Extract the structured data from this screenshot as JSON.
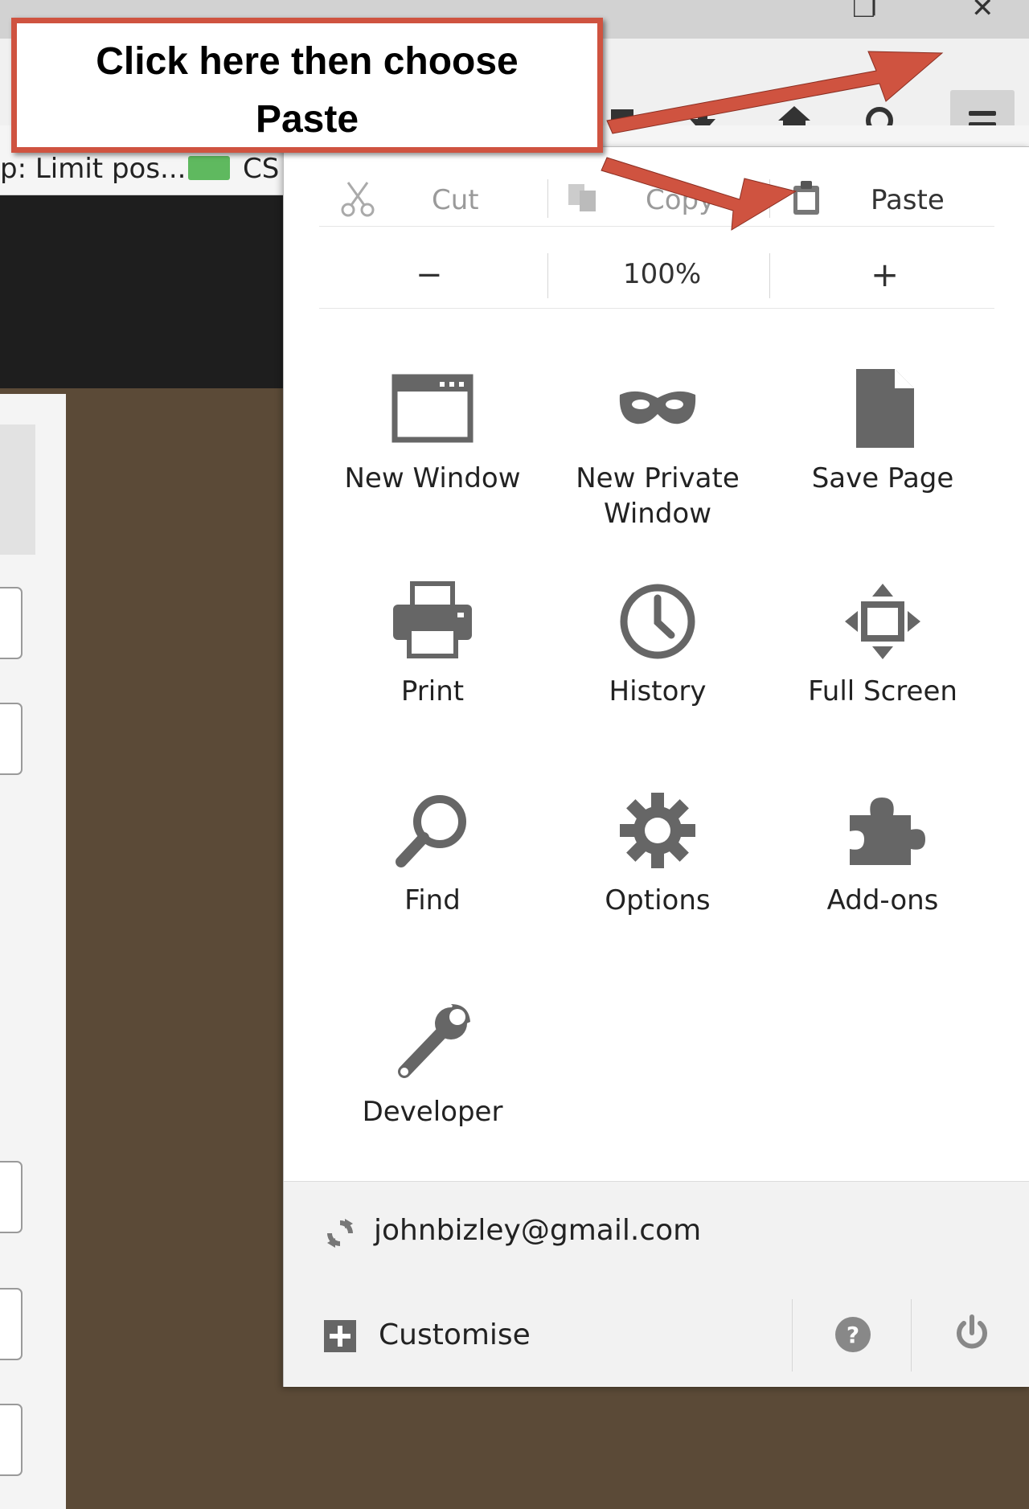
{
  "browser": {
    "bookmark_label": "p: Limit pos...",
    "bookmark_label_2": "CS"
  },
  "callout": {
    "line1": "Click here then choose",
    "line2": "Paste",
    "color": "#cf5340"
  },
  "menu": {
    "cut": "Cut",
    "copy": "Copy",
    "paste": "Paste",
    "zoom_out": "−",
    "zoom_level": "100%",
    "zoom_in": "+",
    "items": {
      "new_window": "New Window",
      "new_private_line1": "New Private",
      "new_private_line2": "Window",
      "save_page": "Save Page",
      "print": "Print",
      "history": "History",
      "full_screen": "Full Screen",
      "find": "Find",
      "options": "Options",
      "addons": "Add-ons",
      "developer": "Developer"
    },
    "account": "johnbizley@gmail.com",
    "customise": "Customise"
  },
  "icons": [
    "cut-icon",
    "copy-icon",
    "paste-icon",
    "window-icon",
    "mask-icon",
    "page-icon",
    "printer-icon",
    "clock-icon",
    "fullscreen-icon",
    "search-icon",
    "gear-icon",
    "puzzle-icon",
    "wrench-icon",
    "sync-icon",
    "plus-icon",
    "help-icon",
    "power-icon",
    "hamburger-menu-icon"
  ]
}
